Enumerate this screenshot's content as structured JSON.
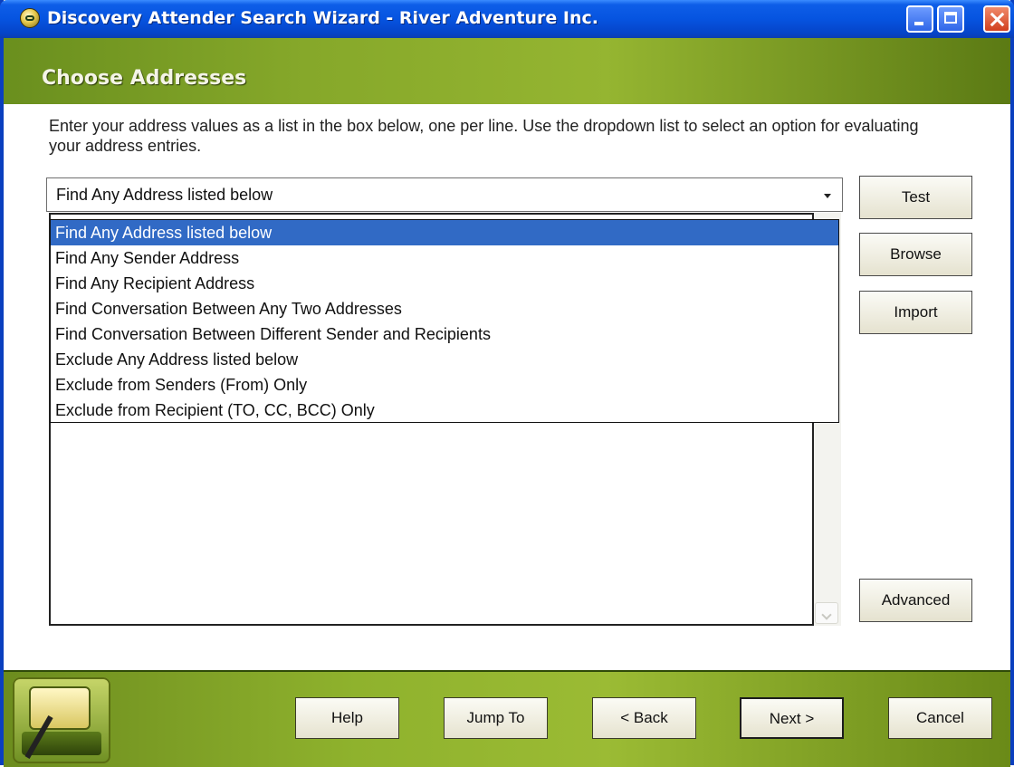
{
  "window": {
    "title": "Discovery Attender Search Wizard - River Adventure Inc."
  },
  "header": {
    "title": "Choose Addresses"
  },
  "instructions": "Enter your address values as a list in the box below, one per line.  Use the dropdown list to select an option for evaluating your address entries.",
  "combo": {
    "selected": "Find Any Address listed below",
    "options": [
      "Find Any Address listed below",
      "Find Any Sender Address",
      "Find Any Recipient Address",
      "Find Conversation Between Any Two Addresses",
      "Find Conversation Between Different Sender and Recipients",
      "Exclude Any Address listed below",
      "Exclude from Senders (From) Only",
      "Exclude from Recipient (TO, CC, BCC) Only"
    ]
  },
  "side_buttons": {
    "test": "Test",
    "browse": "Browse",
    "import": "Import",
    "advanced": "Advanced"
  },
  "footer": {
    "help": "Help",
    "jump_to": "Jump To",
    "back": "< Back",
    "next": "Next >",
    "cancel": "Cancel"
  },
  "colors": {
    "title_bar": "#0654e0",
    "header_green": "#86a82a",
    "selection": "#316ac5"
  }
}
